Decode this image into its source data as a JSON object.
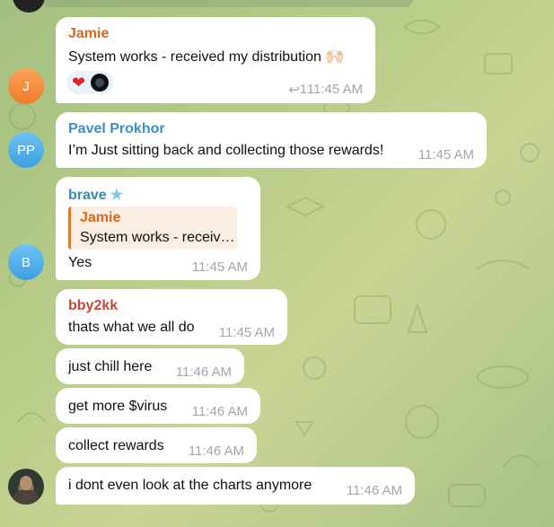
{
  "colors": {
    "jamie": "#d4681f",
    "pavel": "#3b8ec9",
    "brave": "#2f8fb0",
    "bby2kk": "#c9453a",
    "time": "#a0a7ad"
  },
  "avatars": {
    "jamie": "J",
    "pavel": "PP",
    "brave": "B"
  },
  "messages": {
    "jamie": {
      "sender": "Jamie",
      "text": "System works - received my distribution",
      "emoji": "🙌🏻",
      "reaction": "❤",
      "reply_count": "1",
      "time": "11:45 AM"
    },
    "pavel": {
      "sender": "Pavel Prokhor",
      "text": "I’m Just sitting back and collecting those rewards!",
      "time": "11:45 AM"
    },
    "brave": {
      "sender": "brave",
      "quote_sender": "Jamie",
      "quote_text": "System works - receiv…",
      "text": "Yes",
      "time": "11:45 AM"
    },
    "bby_1": {
      "sender": "bby2kk",
      "text": "thats what we all do",
      "time": "11:45 AM"
    },
    "bby_2": {
      "text": "just chill here",
      "time": "11:46 AM"
    },
    "bby_3": {
      "text": "get more $virus",
      "time": "11:46 AM"
    },
    "bby_4": {
      "text": "collect rewards",
      "time": "11:46 AM"
    },
    "bby_5": {
      "text": "i dont even look at the charts anymore",
      "time": "11:46 AM"
    }
  }
}
